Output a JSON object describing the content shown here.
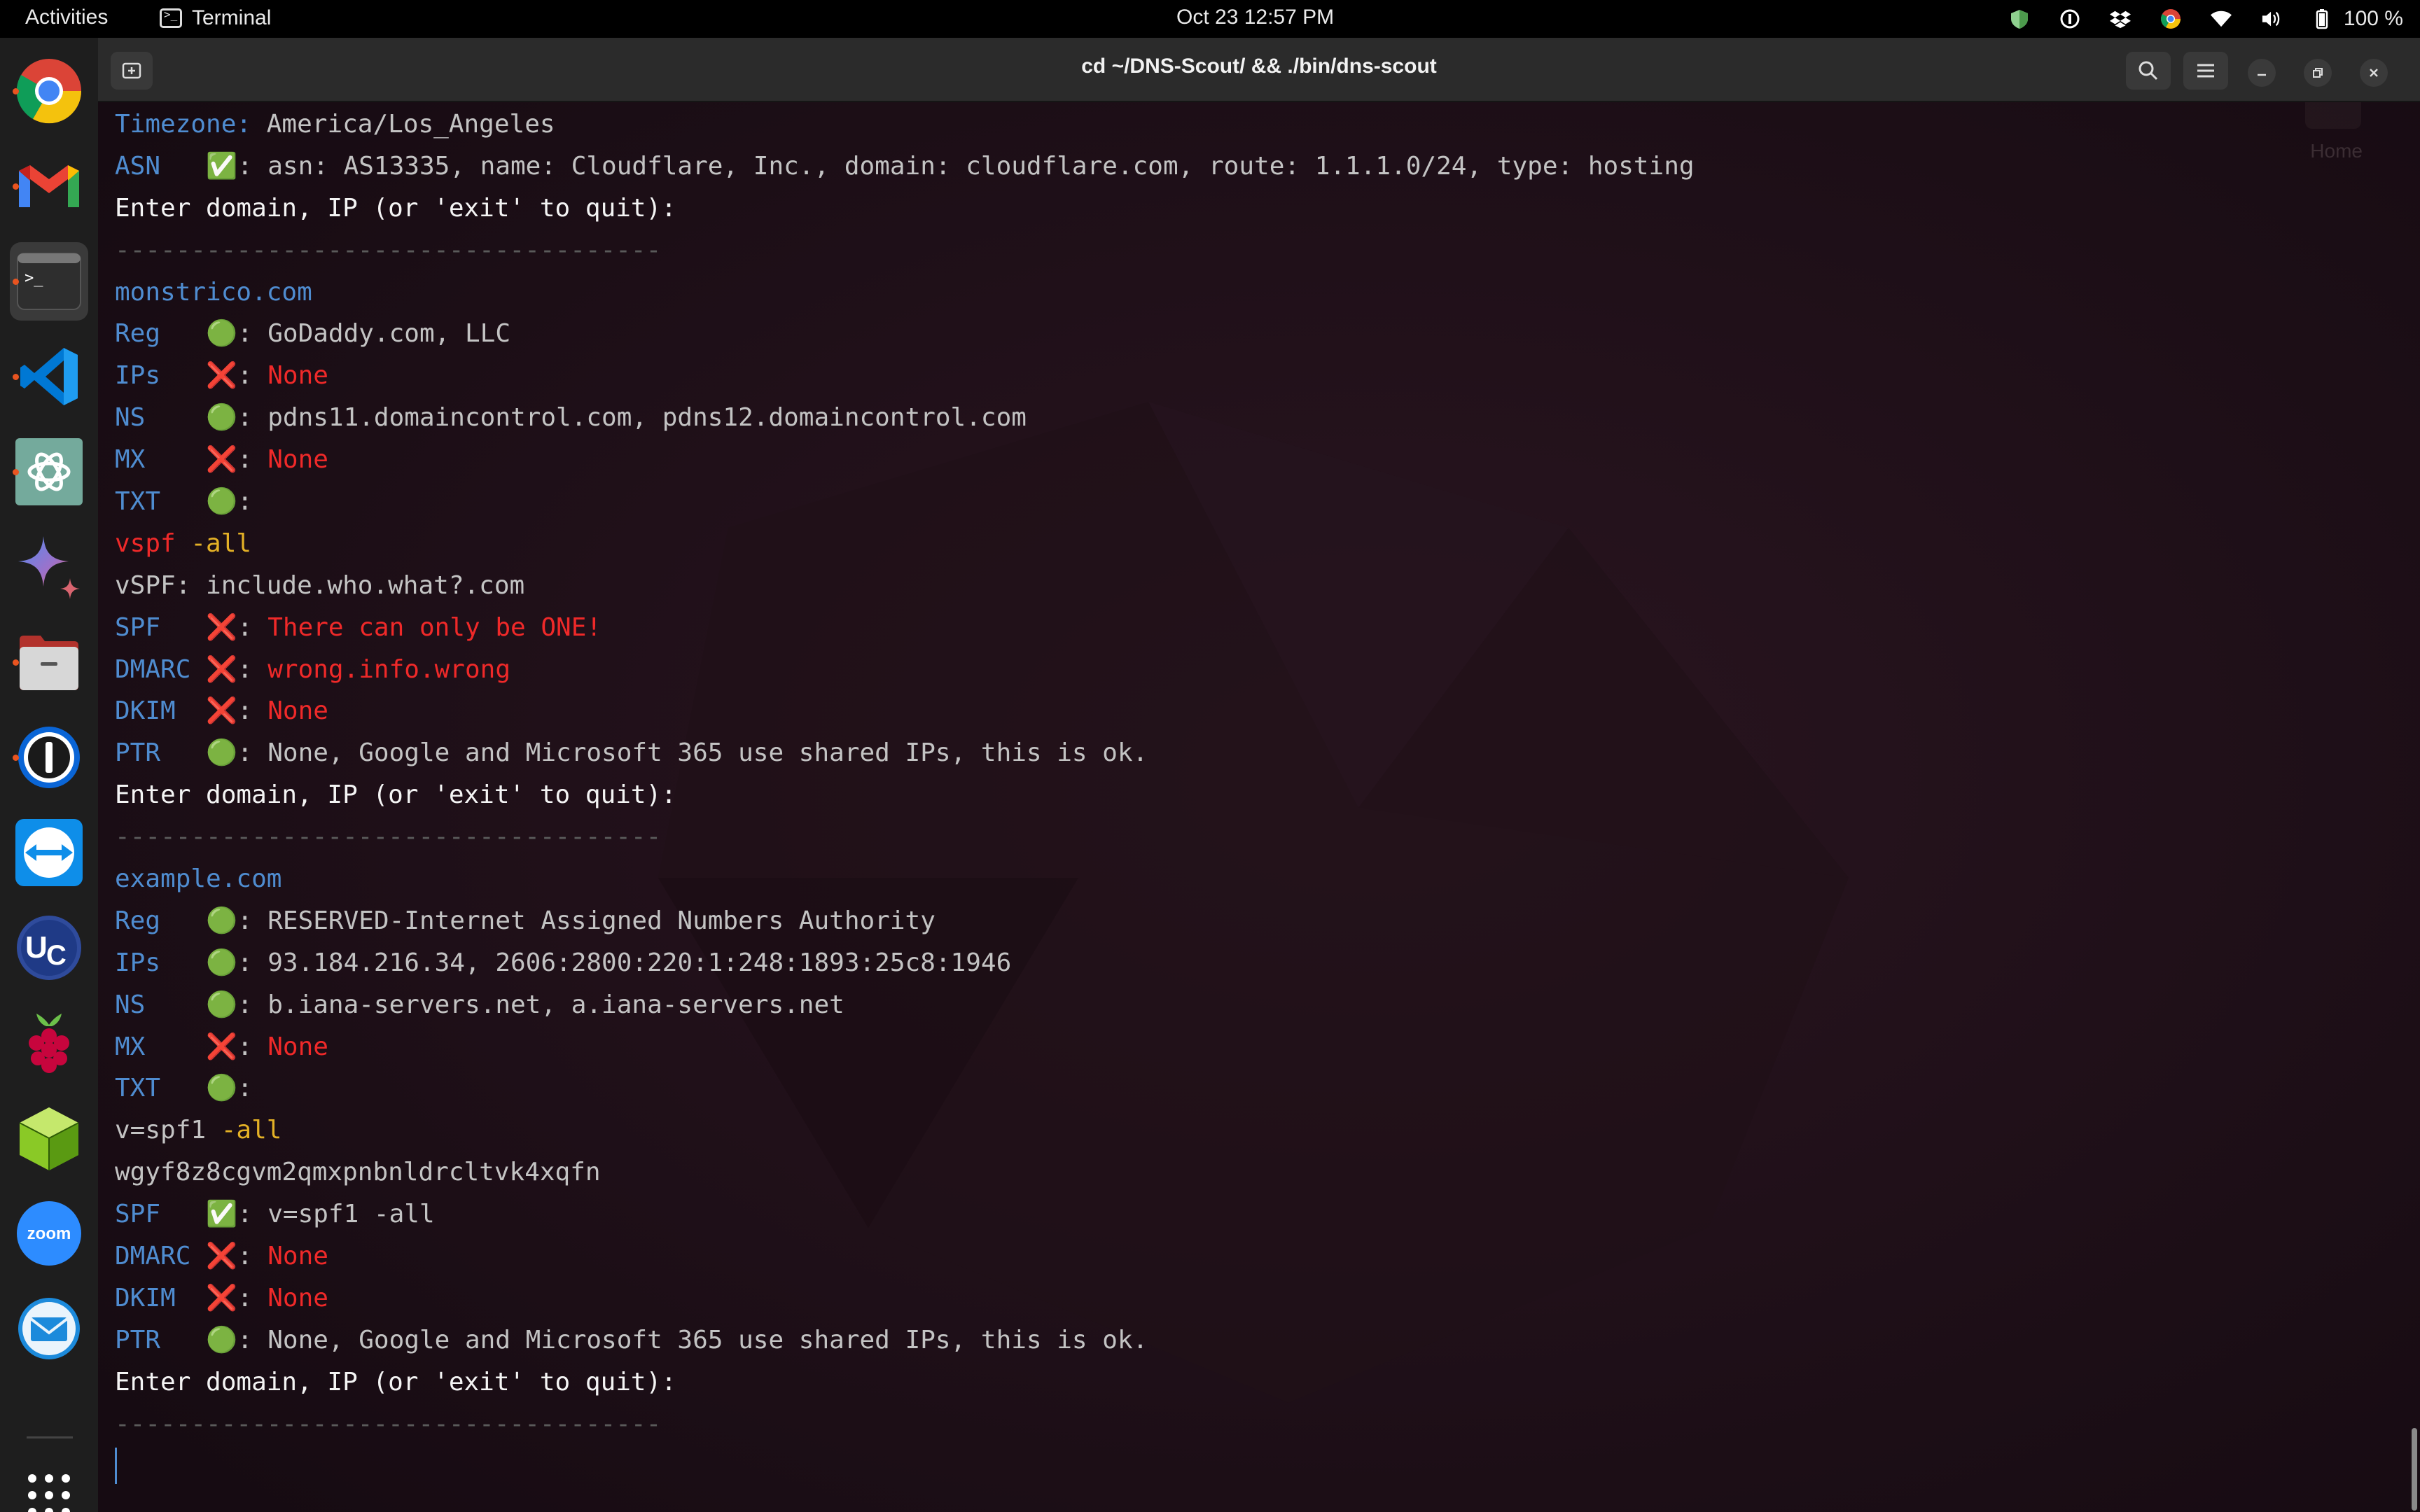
{
  "topbar": {
    "activities": "Activities",
    "app_name": "Terminal",
    "clock": "Oct 23  12:57 PM",
    "battery": "100 %",
    "colors": {
      "bg": "#000000",
      "accent": "#e95420"
    }
  },
  "dock": {
    "items": [
      {
        "name": "chrome-icon",
        "running": true
      },
      {
        "name": "gmail-icon",
        "running": true
      },
      {
        "name": "terminal-icon",
        "running": true,
        "active": true
      },
      {
        "name": "vscode-icon",
        "running": true
      },
      {
        "name": "chatgpt-icon",
        "running": true
      },
      {
        "name": "gemini-icon",
        "running": false
      },
      {
        "name": "files-icon",
        "running": true
      },
      {
        "name": "1password-icon",
        "running": true
      },
      {
        "name": "teamviewer-icon",
        "running": false
      },
      {
        "name": "ultracompare-icon",
        "running": false
      },
      {
        "name": "raspberry-pi-icon",
        "running": false
      },
      {
        "name": "cube-app-icon",
        "running": false
      },
      {
        "name": "zoom-icon",
        "running": false
      },
      {
        "name": "mail-icon",
        "running": false
      },
      {
        "name": "show-apps-icon",
        "running": false
      }
    ]
  },
  "window": {
    "title": "cd ~/DNS-Scout/ && ./bin/dns-scout",
    "home_label": "Home"
  },
  "terminal": {
    "lines": [
      [
        {
          "t": "Timezone: ",
          "c": "key"
        },
        {
          "t": "America/Los_Angeles",
          "c": "val"
        }
      ],
      [
        {
          "t": "ASN   ",
          "c": "key"
        },
        {
          "t": "✅: ",
          "c": "icon"
        },
        {
          "t": "asn: AS13335, name: Cloudflare, Inc., domain: cloudflare.com, route: 1.1.1.0/24, type: hosting",
          "c": "val"
        }
      ],
      [
        {
          "t": "Enter domain, IP (or 'exit' to quit):",
          "c": "prompt"
        }
      ],
      [
        {
          "t": "------------------------------------",
          "c": "sep"
        }
      ],
      [
        {
          "t": "monstrico.com",
          "c": "dom"
        }
      ],
      [
        {
          "t": "Reg   ",
          "c": "key"
        },
        {
          "t": "🟢: ",
          "c": "icon"
        },
        {
          "t": "GoDaddy.com, LLC",
          "c": "val"
        }
      ],
      [
        {
          "t": "IPs   ",
          "c": "key"
        },
        {
          "t": "❌: ",
          "c": "icon"
        },
        {
          "t": "None",
          "c": "bad"
        }
      ],
      [
        {
          "t": "NS    ",
          "c": "key"
        },
        {
          "t": "🟢: ",
          "c": "icon"
        },
        {
          "t": "pdns11.domaincontrol.com, pdns12.domaincontrol.com",
          "c": "val"
        }
      ],
      [
        {
          "t": "MX    ",
          "c": "key"
        },
        {
          "t": "❌: ",
          "c": "icon"
        },
        {
          "t": "None",
          "c": "bad"
        }
      ],
      [
        {
          "t": "TXT   ",
          "c": "key"
        },
        {
          "t": "🟢:",
          "c": "icon"
        }
      ],
      [
        {
          "t": "vspf ",
          "c": "bad"
        },
        {
          "t": "-all",
          "c": "warn"
        }
      ],
      [
        {
          "t": "vSPF: include.who.what?.com",
          "c": "val"
        }
      ],
      [
        {
          "t": "SPF   ",
          "c": "key"
        },
        {
          "t": "❌: ",
          "c": "icon"
        },
        {
          "t": "There can only be ONE!",
          "c": "bad"
        }
      ],
      [
        {
          "t": "DMARC ",
          "c": "key"
        },
        {
          "t": "❌: ",
          "c": "icon"
        },
        {
          "t": "wrong.info.wrong",
          "c": "bad"
        }
      ],
      [
        {
          "t": "DKIM  ",
          "c": "key"
        },
        {
          "t": "❌: ",
          "c": "icon"
        },
        {
          "t": "None",
          "c": "bad"
        }
      ],
      [
        {
          "t": "PTR   ",
          "c": "key"
        },
        {
          "t": "🟢: ",
          "c": "icon"
        },
        {
          "t": "None, Google and Microsoft 365 use shared IPs, this is ok.",
          "c": "val"
        }
      ],
      [
        {
          "t": "Enter domain, IP (or 'exit' to quit):",
          "c": "prompt"
        }
      ],
      [
        {
          "t": "------------------------------------",
          "c": "sep"
        }
      ],
      [
        {
          "t": "example.com",
          "c": "dom"
        }
      ],
      [
        {
          "t": "Reg   ",
          "c": "key"
        },
        {
          "t": "🟢: ",
          "c": "icon"
        },
        {
          "t": "RESERVED-Internet Assigned Numbers Authority",
          "c": "val"
        }
      ],
      [
        {
          "t": "IPs   ",
          "c": "key"
        },
        {
          "t": "🟢: ",
          "c": "icon"
        },
        {
          "t": "93.184.216.34, 2606:2800:220:1:248:1893:25c8:1946",
          "c": "val"
        }
      ],
      [
        {
          "t": "NS    ",
          "c": "key"
        },
        {
          "t": "🟢: ",
          "c": "icon"
        },
        {
          "t": "b.iana-servers.net, a.iana-servers.net",
          "c": "val"
        }
      ],
      [
        {
          "t": "MX    ",
          "c": "key"
        },
        {
          "t": "❌: ",
          "c": "icon"
        },
        {
          "t": "None",
          "c": "bad"
        }
      ],
      [
        {
          "t": "TXT   ",
          "c": "key"
        },
        {
          "t": "🟢:",
          "c": "icon"
        }
      ],
      [
        {
          "t": "v=spf1 ",
          "c": "val"
        },
        {
          "t": "-all",
          "c": "warn"
        }
      ],
      [
        {
          "t": "wgyf8z8cgvm2qmxpnbnldrcltvk4xqfn",
          "c": "val"
        }
      ],
      [
        {
          "t": "SPF   ",
          "c": "key"
        },
        {
          "t": "✅: ",
          "c": "icon"
        },
        {
          "t": "v=spf1 -all",
          "c": "val"
        }
      ],
      [
        {
          "t": "DMARC ",
          "c": "key"
        },
        {
          "t": "❌: ",
          "c": "icon"
        },
        {
          "t": "None",
          "c": "bad"
        }
      ],
      [
        {
          "t": "DKIM  ",
          "c": "key"
        },
        {
          "t": "❌: ",
          "c": "icon"
        },
        {
          "t": "None",
          "c": "bad"
        }
      ],
      [
        {
          "t": "PTR   ",
          "c": "key"
        },
        {
          "t": "🟢: ",
          "c": "icon"
        },
        {
          "t": "None, Google and Microsoft 365 use shared IPs, this is ok.",
          "c": "val"
        }
      ],
      [
        {
          "t": "Enter domain, IP (or 'exit' to quit):",
          "c": "prompt"
        }
      ],
      [
        {
          "t": "------------------------------------",
          "c": "sep"
        }
      ]
    ]
  }
}
